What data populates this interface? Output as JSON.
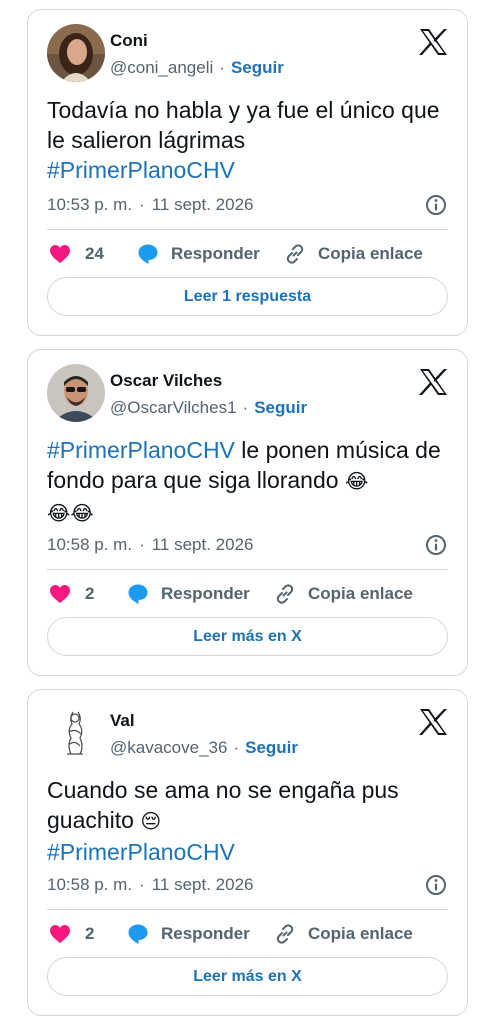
{
  "tweets": [
    {
      "display_name": "Coni",
      "handle": "@coni_angeli",
      "follow_label": "Seguir",
      "text": "Todavía no habla y ya fue el único que le salieron lágrimas",
      "hashtag": "#PrimerPlanoCHV",
      "time": "10:53 p. m.",
      "date": "11 sept. 2026",
      "likes": "24",
      "reply_label": "Responder",
      "copy_label": "Copia enlace",
      "cta_label": "Leer 1 respuesta"
    },
    {
      "display_name": "Oscar Vilches",
      "handle": "@OscarVilches1",
      "follow_label": "Seguir",
      "hashtag": "#PrimerPlanoCHV",
      "text": "le ponen música de fondo para que siga llorando",
      "emojis_inline": "😂",
      "emojis_line2": "😂😂",
      "time": "10:58 p. m.",
      "date": "11 sept. 2026",
      "likes": "2",
      "reply_label": "Responder",
      "copy_label": "Copia enlace",
      "cta_label": "Leer más en X"
    },
    {
      "display_name": "Val",
      "handle": "@kavacove_36",
      "follow_label": "Seguir",
      "text": "Cuando se ama no se engaña pus guachito",
      "emoji": "😔",
      "hashtag": "#PrimerPlanoCHV",
      "time": "10:58 p. m.",
      "date": "11 sept. 2026",
      "likes": "2",
      "reply_label": "Responder",
      "copy_label": "Copia enlace",
      "cta_label": "Leer más en X"
    }
  ],
  "separator": "·",
  "colors": {
    "link": "#1d72b8",
    "like": "#f91880",
    "reply": "#1d9bf0",
    "muted": "#536471",
    "border": "#cfd9de"
  },
  "icons": [
    "x-logo-icon",
    "info-icon",
    "heart-icon",
    "reply-bubble-icon",
    "link-icon"
  ]
}
